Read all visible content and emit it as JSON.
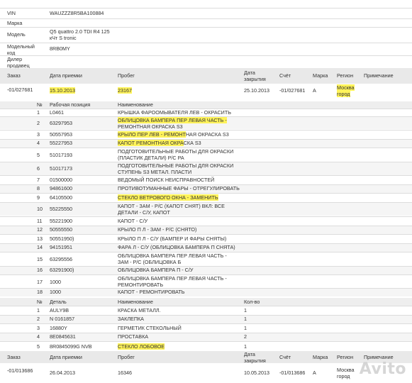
{
  "vehicle": {
    "fields": [
      {
        "label": "VIN",
        "value": "WAUZZZ8R5BA100884"
      },
      {
        "label": "Марка",
        "value": ""
      },
      {
        "label": "Модель",
        "value": "Q5 quattro 2.0 TDI R4 125 кЧт S tronic"
      },
      {
        "label": "Модельный код",
        "value": "8RB0MY"
      },
      {
        "label": "Дилер продавец",
        "value": ""
      }
    ]
  },
  "order_headers": [
    "Заказ",
    "Дата приемки",
    "Пробег",
    "Дата закрытия",
    "Счёт",
    "Марка",
    "Регион",
    "Примечание"
  ],
  "order1": {
    "order": "-01/027681",
    "date_in": "15.10.2013",
    "mileage": "23167",
    "date_close": "25.10.2013",
    "account": "-01/027681",
    "brand": "A",
    "region": "Москва город",
    "note": ""
  },
  "works_headers": [
    "№",
    "Рабочая позиция",
    "Наименование"
  ],
  "works": [
    {
      "n": "1",
      "code": "L0461",
      "name": "КРЫШКА ФАРООМЫВАТЕЛЯ ЛЕВ - ОКРАСИТЬ"
    },
    {
      "n": "2",
      "code": "63297953",
      "name_hl": "ОБЛИЦОВКА БАМПЕРА ПЕР ЛЕВАЯ ЧАСТЬ -",
      "name_rest": " РЕМОНТНАЯ ОКРАСКА S3"
    },
    {
      "n": "3",
      "code": "50557953",
      "name_hl": "КРЫЛО ПЕР ЛЕВ - РЕМОНТ",
      "name_rest": "НАЯ ОКРАСКА S3"
    },
    {
      "n": "4",
      "code": "55227953",
      "name_hl": "КАПОТ РЕМОНТНАЯ ОКРА",
      "name_rest": "СКА S3"
    },
    {
      "n": "5",
      "code": "51017193",
      "name": "ПОДГОТОВИТЕЛЬНЫЕ РАБОТЫ ДЛЯ ОКРАСКИ (ПЛАСТИК ДЕТАЛИ) Р/С РА"
    },
    {
      "n": "6",
      "code": "51017173",
      "name": "ПОДГОТОВИТЕЛЬНЫЕ РАБОТЫ ДЛЯ ОКРАСКИ СТУПЕНЬ S3 МЕТАЛ. ПЛАСТИ"
    },
    {
      "n": "7",
      "code": "01500000",
      "name": "ВЕДОМЫЙ ПОИСК НЕИСПРАВНОСТЕЙ"
    },
    {
      "n": "8",
      "code": "94861600",
      "name": "ПРОТИВОТУМАННЫЕ ФАРЫ - ОТРЕГУЛИРОВАТЬ"
    },
    {
      "n": "9",
      "code": "64105500",
      "name_hl": "СТЕКЛО ВЕТРОВОГО ОКНА - ЗАМЕНИТЬ",
      "name_rest": ""
    },
    {
      "n": "10",
      "code": "55225550",
      "name": "КАПОТ - ЗАМ - Р/С (КАПОТ СНЯТ) ВКЛ: ВСЕ ДЕТАЛИ - С/У, КАПОТ"
    },
    {
      "n": "11",
      "code": "55221900",
      "name": "КАПОТ - С/У"
    },
    {
      "n": "12",
      "code": "50555550",
      "name": "КРЫЛО П Л - ЗАМ - Р/С (СНЯТО)"
    },
    {
      "n": "13",
      "code": "50551950)",
      "name": "КРЫЛО П Л - С/У (БАМПЕР И ФАРЫ СНЯТЫ)"
    },
    {
      "n": "14",
      "code": "94151951",
      "name": "ФАРА Л - С/У (ОБЛИЦОВКА БАМПЕРА П СНЯТА)"
    },
    {
      "n": "15",
      "code": "63295556",
      "name": "ОБЛИЦОВКА БАМПЕРА ПЕР ЛЕВАЯ ЧАСТЬ - ЗАМ - Р/С (ОБЛИЦОВКА Б"
    },
    {
      "n": "16",
      "code": "63291900)",
      "name": "ОБЛИЦОВКА БАМПЕРА П - С/У"
    },
    {
      "n": "17",
      "code": "1000",
      "name": "ОБЛИЦОВКА БАМПЕРА ПЕР ЛЕВАЯ ЧАСТЬ - РЕМОНТИРОВАТЬ"
    },
    {
      "n": "18",
      "code": "1000",
      "name": "КАПОТ - РЕМОНТИРОВАТЬ"
    }
  ],
  "parts_headers": [
    "№",
    "Деталь",
    "Наименование",
    "Кол-во"
  ],
  "parts": [
    {
      "n": "1",
      "part": "AULY9B",
      "name": "КРАСКА МЕТАЛЛ.",
      "qty": "1"
    },
    {
      "n": "2",
      "part": "N 0161857",
      "name": "ЗАКЛЕПКА",
      "qty": "1"
    },
    {
      "n": "3",
      "part": "16880Y",
      "name": "ГЕРМЕТИК СТЕКОЛЬНЫЙ",
      "qty": "1"
    },
    {
      "n": "4",
      "part": "8E0845631",
      "name": "ПРОСТАВКА",
      "qty": "2"
    },
    {
      "n": "5",
      "part": "8R0845099G NVB",
      "name_hl": "СТЕКЛО ЛОБОВОЕ",
      "qty": "1"
    }
  ],
  "order2": {
    "order": "-01/013686",
    "date_in": "26.04.2013",
    "mileage": "16346",
    "date_close": "10.05.2013",
    "account": "-01/013686",
    "brand": "A",
    "region": "Москва город",
    "note": ""
  },
  "watermark": "Avito",
  "colors": {
    "highlight": "#fff35a",
    "header_band": "#e9e9e9",
    "line": "#dcdcdc"
  }
}
